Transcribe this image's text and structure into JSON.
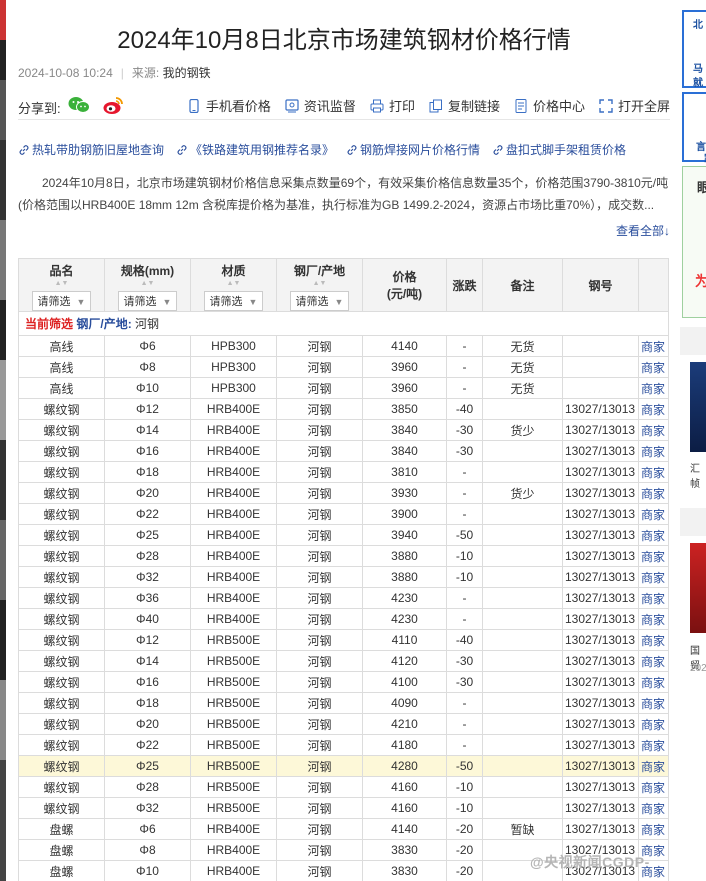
{
  "article": {
    "title": "2024年10月8日北京市场建筑钢材价格行情",
    "date": "2024-10-08 10:24",
    "source_label": "来源:",
    "source_value": "我的钢铁"
  },
  "share": {
    "label": "分享到:",
    "tools": [
      {
        "label": "手机看价格",
        "icon": "mobile-icon"
      },
      {
        "label": "资讯监督",
        "icon": "supervise-icon"
      },
      {
        "label": "打印",
        "icon": "printer-icon"
      },
      {
        "label": "复制链接",
        "icon": "copy-link-icon"
      },
      {
        "label": "价格中心",
        "icon": "price-center-icon"
      },
      {
        "label": "打开全屏",
        "icon": "fullscreen-icon"
      }
    ]
  },
  "related_links": [
    "热轧带肋钢筋旧屋地查询",
    "《铁路建筑用钢推荐名录》",
    "钢筋焊接网片价格行情",
    "盘扣式脚手架租赁价格"
  ],
  "summary": "2024年10月8日，北京市场建筑钢材价格信息采集点数量69个，有效采集价格信息数量35个，价格范围3790-3810元/吨(价格范围以HRB400E 18mm 12m 含税库提价格为基准，执行标准为GB 1499.2-2024，资源占市场比重70%），成交数...",
  "view_all": "查看全部↓",
  "table": {
    "headers": {
      "name": "品名",
      "spec": "规格(mm)",
      "material": "材质",
      "mill": "钢厂/产地",
      "price": "价格",
      "price_unit": "(元/吨)",
      "change": "涨跌",
      "note": "备注",
      "code": "钢号"
    },
    "filter_label": "请筛选",
    "current_filter": {
      "label": "当前筛选",
      "key": "钢厂/产地:",
      "value": "河钢"
    },
    "rows": [
      {
        "name": "高线",
        "spec": "Φ6",
        "material": "HPB300",
        "mill": "河钢",
        "price": "4140",
        "change": "-",
        "note": "无货",
        "code": "",
        "shop": "商家"
      },
      {
        "name": "高线",
        "spec": "Φ8",
        "material": "HPB300",
        "mill": "河钢",
        "price": "3960",
        "change": "-",
        "note": "无货",
        "code": "",
        "shop": "商家"
      },
      {
        "name": "高线",
        "spec": "Φ10",
        "material": "HPB300",
        "mill": "河钢",
        "price": "3960",
        "change": "-",
        "note": "无货",
        "code": "",
        "shop": "商家"
      },
      {
        "name": "螺纹钢",
        "spec": "Φ12",
        "material": "HRB400E",
        "mill": "河钢",
        "price": "3850",
        "change": "-40",
        "note": "",
        "code": "13027/13013",
        "shop": "商家"
      },
      {
        "name": "螺纹钢",
        "spec": "Φ14",
        "material": "HRB400E",
        "mill": "河钢",
        "price": "3840",
        "change": "-30",
        "note": "货少",
        "code": "13027/13013",
        "shop": "商家"
      },
      {
        "name": "螺纹钢",
        "spec": "Φ16",
        "material": "HRB400E",
        "mill": "河钢",
        "price": "3840",
        "change": "-30",
        "note": "",
        "code": "13027/13013",
        "shop": "商家"
      },
      {
        "name": "螺纹钢",
        "spec": "Φ18",
        "material": "HRB400E",
        "mill": "河钢",
        "price": "3810",
        "change": "-",
        "note": "",
        "code": "13027/13013",
        "shop": "商家"
      },
      {
        "name": "螺纹钢",
        "spec": "Φ20",
        "material": "HRB400E",
        "mill": "河钢",
        "price": "3930",
        "change": "-",
        "note": "货少",
        "code": "13027/13013",
        "shop": "商家"
      },
      {
        "name": "螺纹钢",
        "spec": "Φ22",
        "material": "HRB400E",
        "mill": "河钢",
        "price": "3900",
        "change": "-",
        "note": "",
        "code": "13027/13013",
        "shop": "商家"
      },
      {
        "name": "螺纹钢",
        "spec": "Φ25",
        "material": "HRB400E",
        "mill": "河钢",
        "price": "3940",
        "change": "-50",
        "note": "",
        "code": "13027/13013",
        "shop": "商家"
      },
      {
        "name": "螺纹钢",
        "spec": "Φ28",
        "material": "HRB400E",
        "mill": "河钢",
        "price": "3880",
        "change": "-10",
        "note": "",
        "code": "13027/13013",
        "shop": "商家"
      },
      {
        "name": "螺纹钢",
        "spec": "Φ32",
        "material": "HRB400E",
        "mill": "河钢",
        "price": "3880",
        "change": "-10",
        "note": "",
        "code": "13027/13013",
        "shop": "商家"
      },
      {
        "name": "螺纹钢",
        "spec": "Φ36",
        "material": "HRB400E",
        "mill": "河钢",
        "price": "4230",
        "change": "-",
        "note": "",
        "code": "13027/13013",
        "shop": "商家"
      },
      {
        "name": "螺纹钢",
        "spec": "Φ40",
        "material": "HRB400E",
        "mill": "河钢",
        "price": "4230",
        "change": "-",
        "note": "",
        "code": "13027/13013",
        "shop": "商家"
      },
      {
        "name": "螺纹钢",
        "spec": "Φ12",
        "material": "HRB500E",
        "mill": "河钢",
        "price": "4110",
        "change": "-40",
        "note": "",
        "code": "13027/13013",
        "shop": "商家"
      },
      {
        "name": "螺纹钢",
        "spec": "Φ14",
        "material": "HRB500E",
        "mill": "河钢",
        "price": "4120",
        "change": "-30",
        "note": "",
        "code": "13027/13013",
        "shop": "商家"
      },
      {
        "name": "螺纹钢",
        "spec": "Φ16",
        "material": "HRB500E",
        "mill": "河钢",
        "price": "4100",
        "change": "-30",
        "note": "",
        "code": "13027/13013",
        "shop": "商家"
      },
      {
        "name": "螺纹钢",
        "spec": "Φ18",
        "material": "HRB500E",
        "mill": "河钢",
        "price": "4090",
        "change": "-",
        "note": "",
        "code": "13027/13013",
        "shop": "商家"
      },
      {
        "name": "螺纹钢",
        "spec": "Φ20",
        "material": "HRB500E",
        "mill": "河钢",
        "price": "4210",
        "change": "-",
        "note": "",
        "code": "13027/13013",
        "shop": "商家"
      },
      {
        "name": "螺纹钢",
        "spec": "Φ22",
        "material": "HRB500E",
        "mill": "河钢",
        "price": "4180",
        "change": "-",
        "note": "",
        "code": "13027/13013",
        "shop": "商家"
      },
      {
        "name": "螺纹钢",
        "spec": "Φ25",
        "material": "HRB500E",
        "mill": "河钢",
        "price": "4280",
        "change": "-50",
        "note": "",
        "code": "13027/13013",
        "shop": "商家",
        "highlight": true
      },
      {
        "name": "螺纹钢",
        "spec": "Φ28",
        "material": "HRB500E",
        "mill": "河钢",
        "price": "4160",
        "change": "-10",
        "note": "",
        "code": "13027/13013",
        "shop": "商家"
      },
      {
        "name": "螺纹钢",
        "spec": "Φ32",
        "material": "HRB500E",
        "mill": "河钢",
        "price": "4160",
        "change": "-10",
        "note": "",
        "code": "13027/13013",
        "shop": "商家"
      },
      {
        "name": "盘螺",
        "spec": "Φ6",
        "material": "HRB400E",
        "mill": "河钢",
        "price": "4140",
        "change": "-20",
        "note": "暂缺",
        "code": "13027/13013",
        "shop": "商家"
      },
      {
        "name": "盘螺",
        "spec": "Φ8",
        "material": "HRB400E",
        "mill": "河钢",
        "price": "3830",
        "change": "-20",
        "note": "",
        "code": "13027/13013",
        "shop": "商家"
      },
      {
        "name": "盘螺",
        "spec": "Φ10",
        "material": "HRB400E",
        "mill": "河钢",
        "price": "3830",
        "change": "-20",
        "note": "",
        "code": "13027/13013",
        "shop": "商家"
      }
    ]
  },
  "sidebar": {
    "box1_chars": [
      "北",
      "马",
      "就"
    ],
    "box2_chars": [
      "言",
      "家"
    ],
    "box3_title": "眼",
    "box3_promo": "为",
    "caption1": "汇帧",
    "caption2": "国贸",
    "caption3": "202"
  },
  "footer_watermark": "@央视新闻CGDP-",
  "colors": {
    "link_blue": "#2a4e9c",
    "filter_red": "#d22",
    "highlight_row": "#fdf8d8",
    "header_bg": "#f3f3f3"
  }
}
